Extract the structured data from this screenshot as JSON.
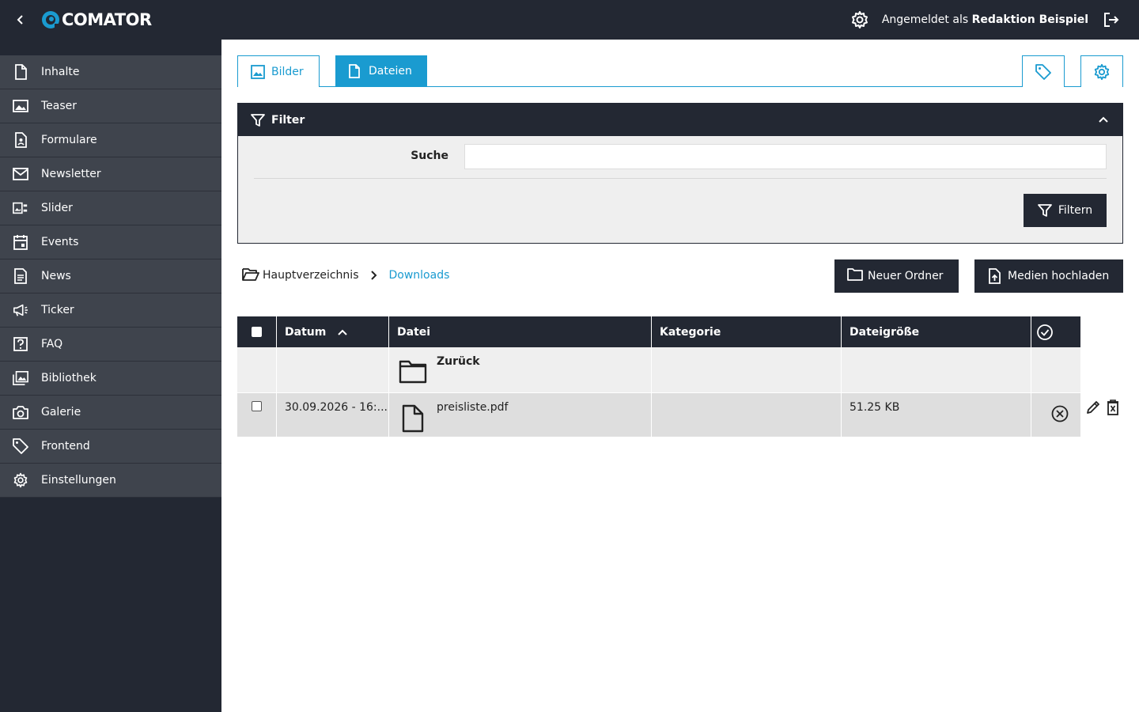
{
  "app": {
    "logo_text": "COMATOR",
    "login_prefix": "Angemeldet als",
    "login_user": "Redaktion Beispiel"
  },
  "sidebar": {
    "items": [
      {
        "label": "Inhalte",
        "icon": "file-icon"
      },
      {
        "label": "Teaser",
        "icon": "image-frame-icon"
      },
      {
        "label": "Formulare",
        "icon": "form-icon"
      },
      {
        "label": "Newsletter",
        "icon": "mail-icon"
      },
      {
        "label": "Slider",
        "icon": "slider-icon"
      },
      {
        "label": "Events",
        "icon": "calendar-icon"
      },
      {
        "label": "News",
        "icon": "document-text-icon"
      },
      {
        "label": "Ticker",
        "icon": "megaphone-icon"
      },
      {
        "label": "FAQ",
        "icon": "question-icon"
      },
      {
        "label": "Bibliothek",
        "icon": "library-icon"
      },
      {
        "label": "Galerie",
        "icon": "camera-icon"
      },
      {
        "label": "Frontend",
        "icon": "tag-icon"
      },
      {
        "label": "Einstellungen",
        "icon": "gear-icon"
      }
    ]
  },
  "tabs": {
    "bilder": "Bilder",
    "dateien": "Dateien"
  },
  "filter": {
    "title": "Filter",
    "search_label": "Suche",
    "search_value": "",
    "search_placeholder": "",
    "button_label": "Filtern"
  },
  "breadcrumb": {
    "root": "Hauptverzeichnis",
    "current": "Downloads"
  },
  "actions": {
    "new_folder": "Neuer Ordner",
    "upload": "Medien hochladen"
  },
  "table": {
    "headers": {
      "datum": "Datum",
      "datei": "Datei",
      "kategorie": "Kategorie",
      "groesse": "Dateigröße"
    },
    "back_row": {
      "label": "Zurück"
    },
    "rows": [
      {
        "datum": "30.09.2026 - 16:...",
        "datei": "preisliste.pdf",
        "kategorie": "",
        "groesse": "51.25 KB"
      }
    ]
  },
  "colors": {
    "dark": "#232833",
    "sidebar_item": "#3f444d",
    "accent": "#1a9bd0",
    "panel_bg": "#efefef"
  }
}
